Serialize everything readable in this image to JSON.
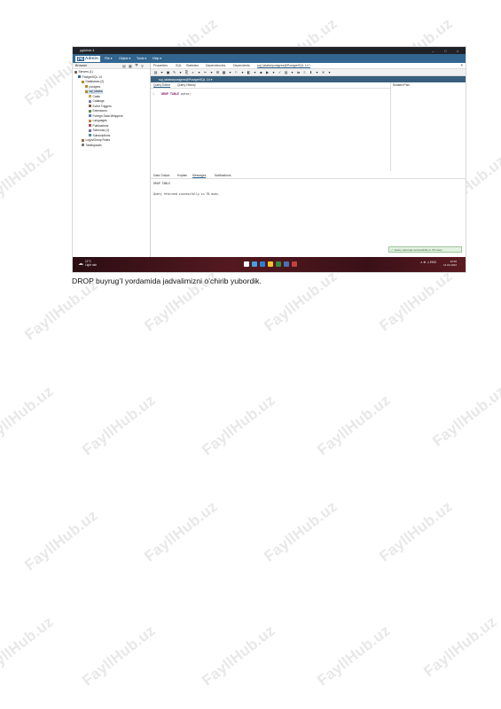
{
  "screenshot": {
    "window_title": "pgAdmin 4",
    "logo_prefix": "pg",
    "logo_text": "Admin",
    "menu": [
      "File ▾",
      "Object ▾",
      "Tools ▾",
      "Help ▾"
    ],
    "browser_label": "Browser",
    "tree": [
      {
        "label": "Servers (1)",
        "color": "#6d6d6d"
      },
      {
        "label": "PostgreSQL 14",
        "color": "#336791"
      },
      {
        "label": "Databases (2)",
        "color": "#b58b2a"
      },
      {
        "label": "postgres",
        "color": "#b58b2a"
      },
      {
        "label": "sql_talaba",
        "color": "#b58b2a"
      },
      {
        "label": "Casts",
        "color": "#c0a040"
      },
      {
        "label": "Catalogs",
        "color": "#7a7aa8"
      },
      {
        "label": "Event Triggers",
        "color": "#8a5a3a"
      },
      {
        "label": "Extensions",
        "color": "#5a8a3a"
      },
      {
        "label": "Foreign Data Wrappers",
        "color": "#5a7aa8"
      },
      {
        "label": "Languages",
        "color": "#c08040"
      },
      {
        "label": "Publications",
        "color": "#a05050"
      },
      {
        "label": "Schemas (1)",
        "color": "#6a6ab0"
      },
      {
        "label": "Subscriptions",
        "color": "#4a8a8a"
      },
      {
        "label": "Login/Group Roles",
        "color": "#9a6a3a"
      },
      {
        "label": "Tablespaces",
        "color": "#7a7a7a"
      }
    ],
    "tabs": [
      "Properties",
      "SQL",
      "Statistics",
      "Dependencies",
      "Dependents",
      "sql_talaba/postgres@PostgreSQL 14 *"
    ],
    "connection": "sql_talaba/postgres@PostgreSQL 14 ▾",
    "editor_tabs": [
      "Query Editor",
      "Query History"
    ],
    "scratch_pad": "Scratch Pad",
    "code_line_no": "1",
    "code_keyword": "DROP TABLE",
    "code_rest": "autor;",
    "output_tabs": [
      "Data Output",
      "Explain",
      "Messages",
      "Notifications"
    ],
    "message_line1": "DROP TABLE",
    "message_line2": "Query returned successfully in 78 msec.",
    "toast": "✓ Query returned successfully in 78 msec.",
    "weather_temp": "11°C",
    "weather_desc": "Light rain",
    "taskbar_icon_colors": [
      "#ffffff",
      "#4a9fd8",
      "#2d7cd6",
      "#f2c230",
      "#3b8a3b",
      "#4b6fb0",
      "#c04040"
    ],
    "tray": "∧ ⊕ ◁ ENG",
    "clock_time": "10:48",
    "clock_date": "14.04.2022"
  },
  "caption": "DROP buyrug’I yordamida jadvalimizni o’chirib yubordik.",
  "watermark": "FayllHub.uz"
}
